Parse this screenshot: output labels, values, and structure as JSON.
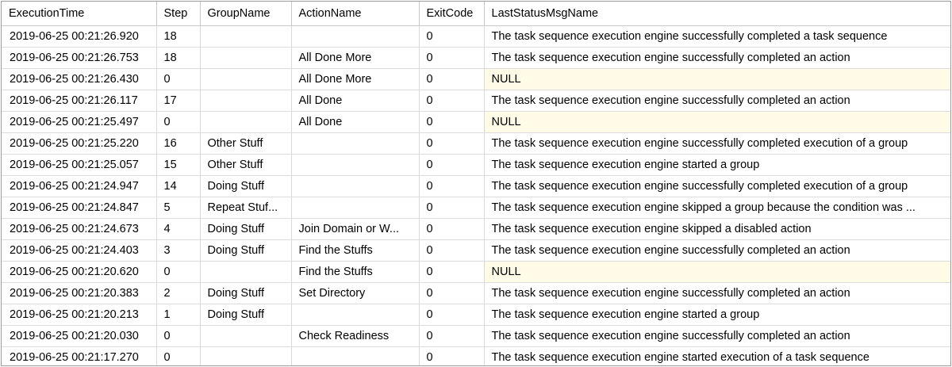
{
  "columns": [
    "ExecutionTime",
    "Step",
    "GroupName",
    "ActionName",
    "ExitCode",
    "LastStatusMsgName"
  ],
  "rows": [
    {
      "time": "2019-06-25 00:21:26.920",
      "step": "18",
      "group": "",
      "action": "",
      "exit": "0",
      "msg": "The task sequence execution engine successfully completed a task sequence"
    },
    {
      "time": "2019-06-25 00:21:26.753",
      "step": "18",
      "group": "",
      "action": "All Done More",
      "exit": "0",
      "msg": "The task sequence execution engine successfully completed an action"
    },
    {
      "time": "2019-06-25 00:21:26.430",
      "step": "0",
      "group": "",
      "action": "All Done More",
      "exit": "0",
      "msg": "NULL"
    },
    {
      "time": "2019-06-25 00:21:26.117",
      "step": "17",
      "group": "",
      "action": "All Done",
      "exit": "0",
      "msg": "The task sequence execution engine successfully completed an action"
    },
    {
      "time": "2019-06-25 00:21:25.497",
      "step": "0",
      "group": "",
      "action": "All Done",
      "exit": "0",
      "msg": "NULL"
    },
    {
      "time": "2019-06-25 00:21:25.220",
      "step": "16",
      "group": "Other Stuff",
      "action": "",
      "exit": "0",
      "msg": "The task sequence execution engine successfully completed execution of a group"
    },
    {
      "time": "2019-06-25 00:21:25.057",
      "step": "15",
      "group": "Other Stuff",
      "action": "",
      "exit": "0",
      "msg": "The task sequence execution engine started a group"
    },
    {
      "time": "2019-06-25 00:21:24.947",
      "step": "14",
      "group": "Doing Stuff",
      "action": "",
      "exit": "0",
      "msg": "The task sequence execution engine successfully completed execution of a group"
    },
    {
      "time": "2019-06-25 00:21:24.847",
      "step": "5",
      "group": "Repeat Stuf...",
      "action": "",
      "exit": "0",
      "msg": "The task sequence execution engine skipped a group because the condition was ..."
    },
    {
      "time": "2019-06-25 00:21:24.673",
      "step": "4",
      "group": "Doing Stuff",
      "action": "Join Domain or W...",
      "exit": "0",
      "msg": "The task sequence execution engine skipped a disabled action"
    },
    {
      "time": "2019-06-25 00:21:24.403",
      "step": "3",
      "group": "Doing Stuff",
      "action": "Find the Stuffs",
      "exit": "0",
      "msg": "The task sequence execution engine successfully completed an action"
    },
    {
      "time": "2019-06-25 00:21:20.620",
      "step": "0",
      "group": "",
      "action": "Find the Stuffs",
      "exit": "0",
      "msg": "NULL"
    },
    {
      "time": "2019-06-25 00:21:20.383",
      "step": "2",
      "group": "Doing Stuff",
      "action": "Set Directory",
      "exit": "0",
      "msg": "The task sequence execution engine successfully completed an action"
    },
    {
      "time": "2019-06-25 00:21:20.213",
      "step": "1",
      "group": "Doing Stuff",
      "action": "",
      "exit": "0",
      "msg": "The task sequence execution engine started a group"
    },
    {
      "time": "2019-06-25 00:21:20.030",
      "step": "0",
      "group": "",
      "action": "Check Readiness",
      "exit": "0",
      "msg": "The task sequence execution engine successfully completed an action"
    },
    {
      "time": "2019-06-25 00:21:17.270",
      "step": "0",
      "group": "",
      "action": "",
      "exit": "0",
      "msg": "The task sequence execution engine started execution of a task sequence"
    }
  ],
  "colors": {
    "null_cell_bg": "#fffbe6",
    "grid_line": "#d9d9d9",
    "frame_border": "#9b9b9b"
  }
}
